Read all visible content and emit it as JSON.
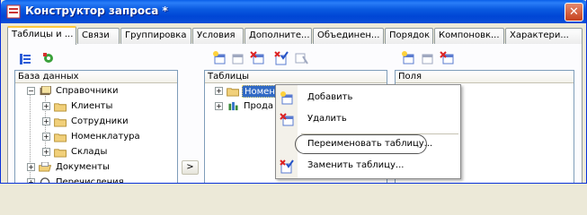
{
  "window": {
    "title": "Конструктор запроса *",
    "close_glyph": "✕"
  },
  "tabs": [
    {
      "label": "Таблицы и ..."
    },
    {
      "label": "Связи"
    },
    {
      "label": "Группировка"
    },
    {
      "label": "Условия"
    },
    {
      "label": "Дополните..."
    },
    {
      "label": "Объединен..."
    },
    {
      "label": "Порядок"
    },
    {
      "label": "Компоновк..."
    },
    {
      "label": "Характери..."
    }
  ],
  "left_panel": {
    "header": "База данных",
    "items": [
      {
        "label": "Справочники"
      },
      {
        "label": "Клиенты"
      },
      {
        "label": "Сотрудники"
      },
      {
        "label": "Номенклатура"
      },
      {
        "label": "Склады"
      },
      {
        "label": "Документы"
      },
      {
        "label": "Перечисления"
      }
    ]
  },
  "middle_panel": {
    "header": "Таблицы",
    "items": [
      {
        "label": "Номен"
      },
      {
        "label": "Прода"
      }
    ]
  },
  "right_panel": {
    "header": "Поля"
  },
  "move_button": {
    "glyph": ">"
  },
  "context_menu": {
    "items": [
      {
        "label": "Добавить",
        "icon": "add-table-icon"
      },
      {
        "label": "Удалить",
        "icon": "delete-table-icon"
      },
      {
        "label": "Переименовать таблицу...",
        "icon": ""
      },
      {
        "label": "Заменить таблицу...",
        "icon": "replace-table-icon"
      }
    ]
  },
  "colors": {
    "titlebar": "#0a5ae0",
    "tab_active_accent": "#ffc83c",
    "selection": "#316ac5",
    "folder": "#f1d07a"
  }
}
